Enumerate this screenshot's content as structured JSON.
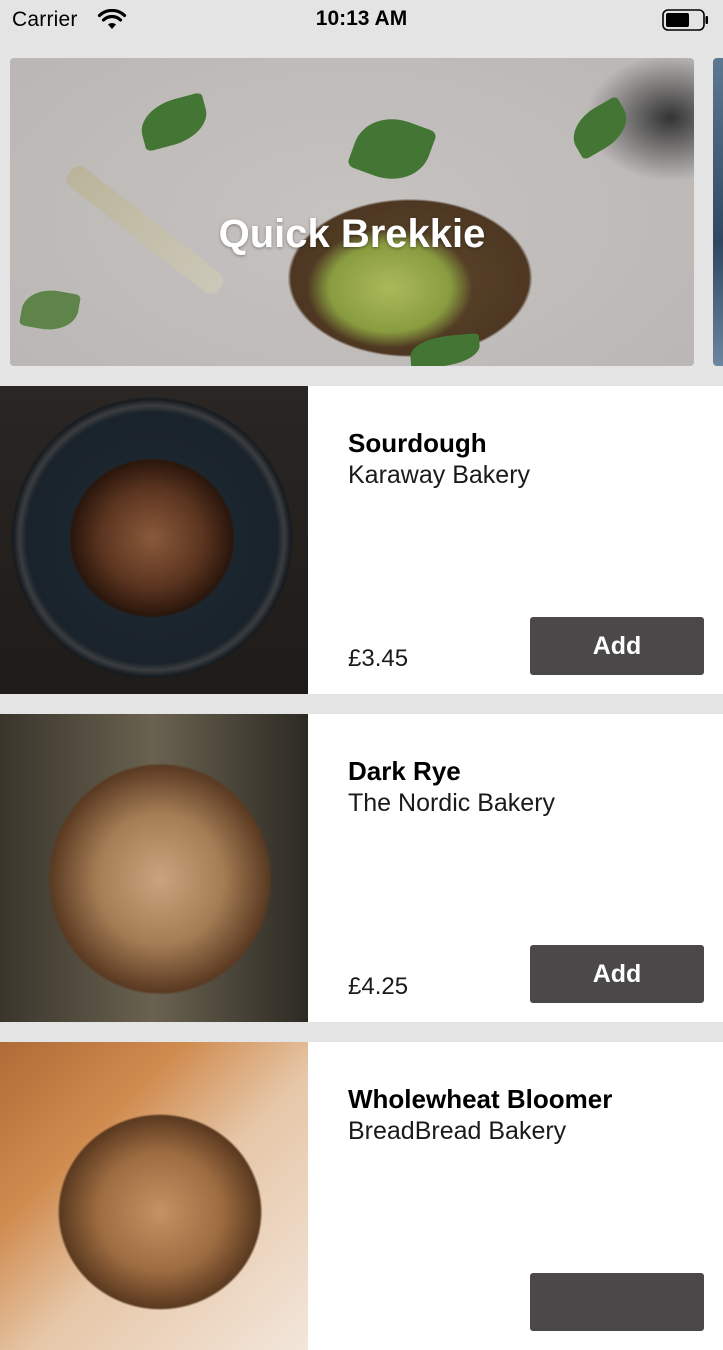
{
  "status_bar": {
    "carrier": "Carrier",
    "time": "10:13 AM",
    "icons": [
      "wifi-icon",
      "battery-icon"
    ]
  },
  "carousel": {
    "cards": [
      {
        "title": "Quick Brekkie"
      }
    ]
  },
  "products": [
    {
      "name": "Sourdough",
      "bakery": "Karaway Bakery",
      "price": "£3.45",
      "add_label": "Add"
    },
    {
      "name": "Dark Rye",
      "bakery": "The Nordic Bakery",
      "price": "£4.25",
      "add_label": "Add"
    },
    {
      "name": "Wholewheat Bloomer",
      "bakery": "BreadBread Bakery",
      "price": "",
      "add_label": ""
    }
  ],
  "colors": {
    "background": "#e4e4e4",
    "card": "#ffffff",
    "button": "#4a4849",
    "button_text": "#ffffff"
  }
}
